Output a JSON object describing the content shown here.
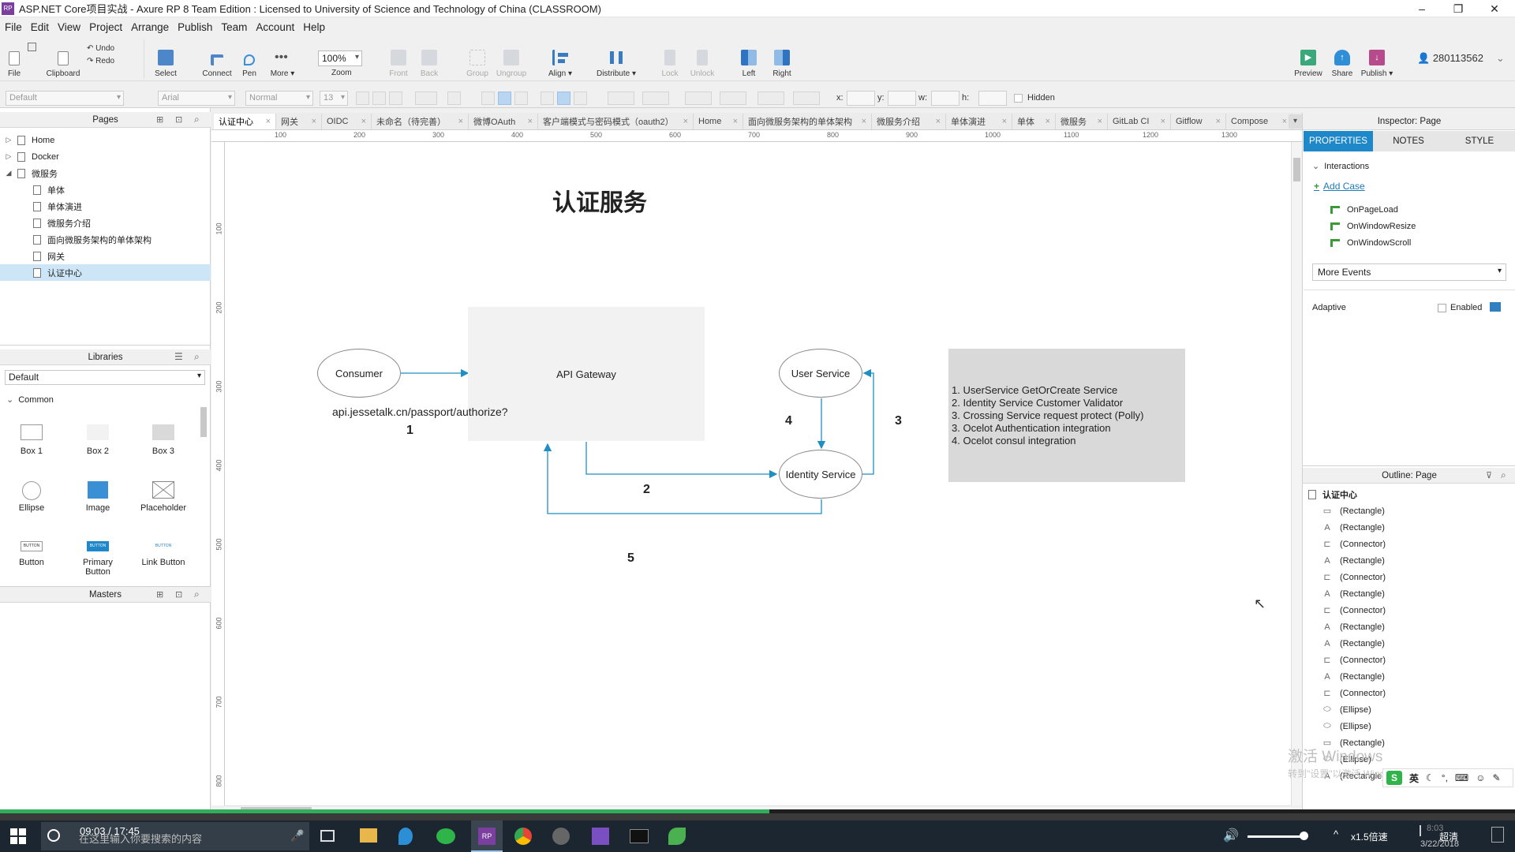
{
  "titlebar": {
    "title": "ASP.NET Core项目实战 - Axure RP 8 Team Edition : Licensed to University of Science and Technology of China (CLASSROOM)",
    "minimize": "–",
    "restore": "❐",
    "close": "✕"
  },
  "menu": [
    "File",
    "Edit",
    "View",
    "Project",
    "Arrange",
    "Publish",
    "Team",
    "Account",
    "Help"
  ],
  "toolbar": {
    "file": "File",
    "clipboard": "Clipboard",
    "undo": "Undo",
    "redo": "Redo",
    "select": "Select",
    "connect": "Connect",
    "pen": "Pen",
    "more": "More ▾",
    "zoom_value": "100%",
    "zoom": "Zoom",
    "front": "Front",
    "back": "Back",
    "group": "Group",
    "ungroup": "Ungroup",
    "align": "Align ▾",
    "distribute": "Distribute ▾",
    "lock": "Lock",
    "unlock": "Unlock",
    "left": "Left",
    "right": "Right",
    "preview": "Preview",
    "share": "Share",
    "publish": "Publish ▾",
    "user": "280113562"
  },
  "formatbar": {
    "style": "Default",
    "font": "Arial",
    "weight": "Normal",
    "size": "13",
    "x_label": "x:",
    "y_label": "y:",
    "w_label": "w:",
    "h_label": "h:",
    "hidden": "Hidden"
  },
  "pages": {
    "header": "Pages",
    "items": [
      {
        "label": "Home",
        "level": 0,
        "expand": "▷"
      },
      {
        "label": "Docker",
        "level": 0,
        "expand": "▷"
      },
      {
        "label": "微服务",
        "level": 0,
        "expand": "◢"
      },
      {
        "label": "单体",
        "level": 1
      },
      {
        "label": "单体演进",
        "level": 1
      },
      {
        "label": "微服务介绍",
        "level": 1
      },
      {
        "label": "面向微服务架构的单体架构",
        "level": 1
      },
      {
        "label": "网关",
        "level": 1
      },
      {
        "label": "认证中心",
        "level": 1,
        "selected": true
      }
    ]
  },
  "libraries": {
    "header": "Libraries",
    "selected": "Default",
    "group": "Common",
    "items": [
      "Box 1",
      "Box 2",
      "Box 3",
      "Ellipse",
      "Image",
      "Placeholder",
      "Button",
      "Primary Button",
      "Link Button"
    ],
    "button_text": "BUTTON"
  },
  "masters": {
    "header": "Masters"
  },
  "tabs": [
    "认证中心",
    "网关",
    "OIDC",
    "未命名（待完善）",
    "微博OAuth",
    "客户端模式与密码模式（oauth2）",
    "Home",
    "面向微服务架构的单体架构",
    "微服务介绍",
    "单体演进",
    "单体",
    "微服务",
    "GitLab CI",
    "Gitflow",
    "Compose"
  ],
  "ruler": {
    "h": [
      "100",
      "200",
      "300",
      "400",
      "500",
      "600",
      "700",
      "800",
      "900",
      "1000",
      "1100",
      "1200",
      "1300"
    ],
    "v": [
      "100",
      "200",
      "300",
      "400",
      "500",
      "600",
      "700",
      "800"
    ]
  },
  "diagram": {
    "title": "认证服务",
    "consumer": "Consumer",
    "gateway": "API Gateway",
    "user_service": "User Service",
    "identity_service": "Identity Service",
    "url": "api.jessetalk.cn/passport/authorize?",
    "n1": "1",
    "n2": "2",
    "n3": "3",
    "n4": "4",
    "n5": "5",
    "notes": [
      "1. UserService GetOrCreate Service",
      "2. Identity Service Customer Validator",
      "3. Crossing Service request protect (Polly)",
      "3. Ocelot Authentication integration",
      "4. Ocelot consul integration"
    ]
  },
  "inspector": {
    "header": "Inspector: Page",
    "tabs": [
      "PROPERTIES",
      "NOTES",
      "STYLE"
    ],
    "interactions": "Interactions",
    "add_case": "Add Case",
    "events": [
      "OnPageLoad",
      "OnWindowResize",
      "OnWindowScroll"
    ],
    "more_events": "More Events",
    "adaptive": "Adaptive",
    "enabled": "Enabled"
  },
  "outline": {
    "header": "Outline: Page",
    "root": "认证中心",
    "items": [
      {
        "label": "(Rectangle)",
        "icon": "rect"
      },
      {
        "label": "(Rectangle)",
        "icon": "text"
      },
      {
        "label": "(Connector)",
        "icon": "conn"
      },
      {
        "label": "(Rectangle)",
        "icon": "text"
      },
      {
        "label": "(Connector)",
        "icon": "conn"
      },
      {
        "label": "(Rectangle)",
        "icon": "text"
      },
      {
        "label": "(Connector)",
        "icon": "conn"
      },
      {
        "label": "(Rectangle)",
        "icon": "text"
      },
      {
        "label": "(Rectangle)",
        "icon": "text"
      },
      {
        "label": "(Connector)",
        "icon": "conn"
      },
      {
        "label": "(Rectangle)",
        "icon": "text"
      },
      {
        "label": "(Connector)",
        "icon": "conn"
      },
      {
        "label": "(Ellipse)",
        "icon": "ellipse"
      },
      {
        "label": "(Ellipse)",
        "icon": "ellipse"
      },
      {
        "label": "(Rectangle)",
        "icon": "rect"
      },
      {
        "label": "(Ellipse)",
        "icon": "ellipse"
      },
      {
        "label": "(Rectangle)",
        "icon": "text"
      }
    ]
  },
  "watermark": {
    "line1": "激活 Windows",
    "line2": "转到\"设置\"以激活 Windows。"
  },
  "ime": {
    "label": "英"
  },
  "taskbar": {
    "video_time": "09:03 / 17:45",
    "search": "在这里输入你要搜索的内容",
    "speed": "x1.5倍速",
    "quality": "超清",
    "time": "8:03",
    "date": "3/22/2018",
    "video_progress": 0.508
  },
  "colors": {
    "accent": "#1e88c8",
    "selection": "#cde6f7",
    "shape_gray": "#f2f2f2",
    "notes_gray": "#d9d9d9",
    "connector": "#1e8fc2"
  }
}
